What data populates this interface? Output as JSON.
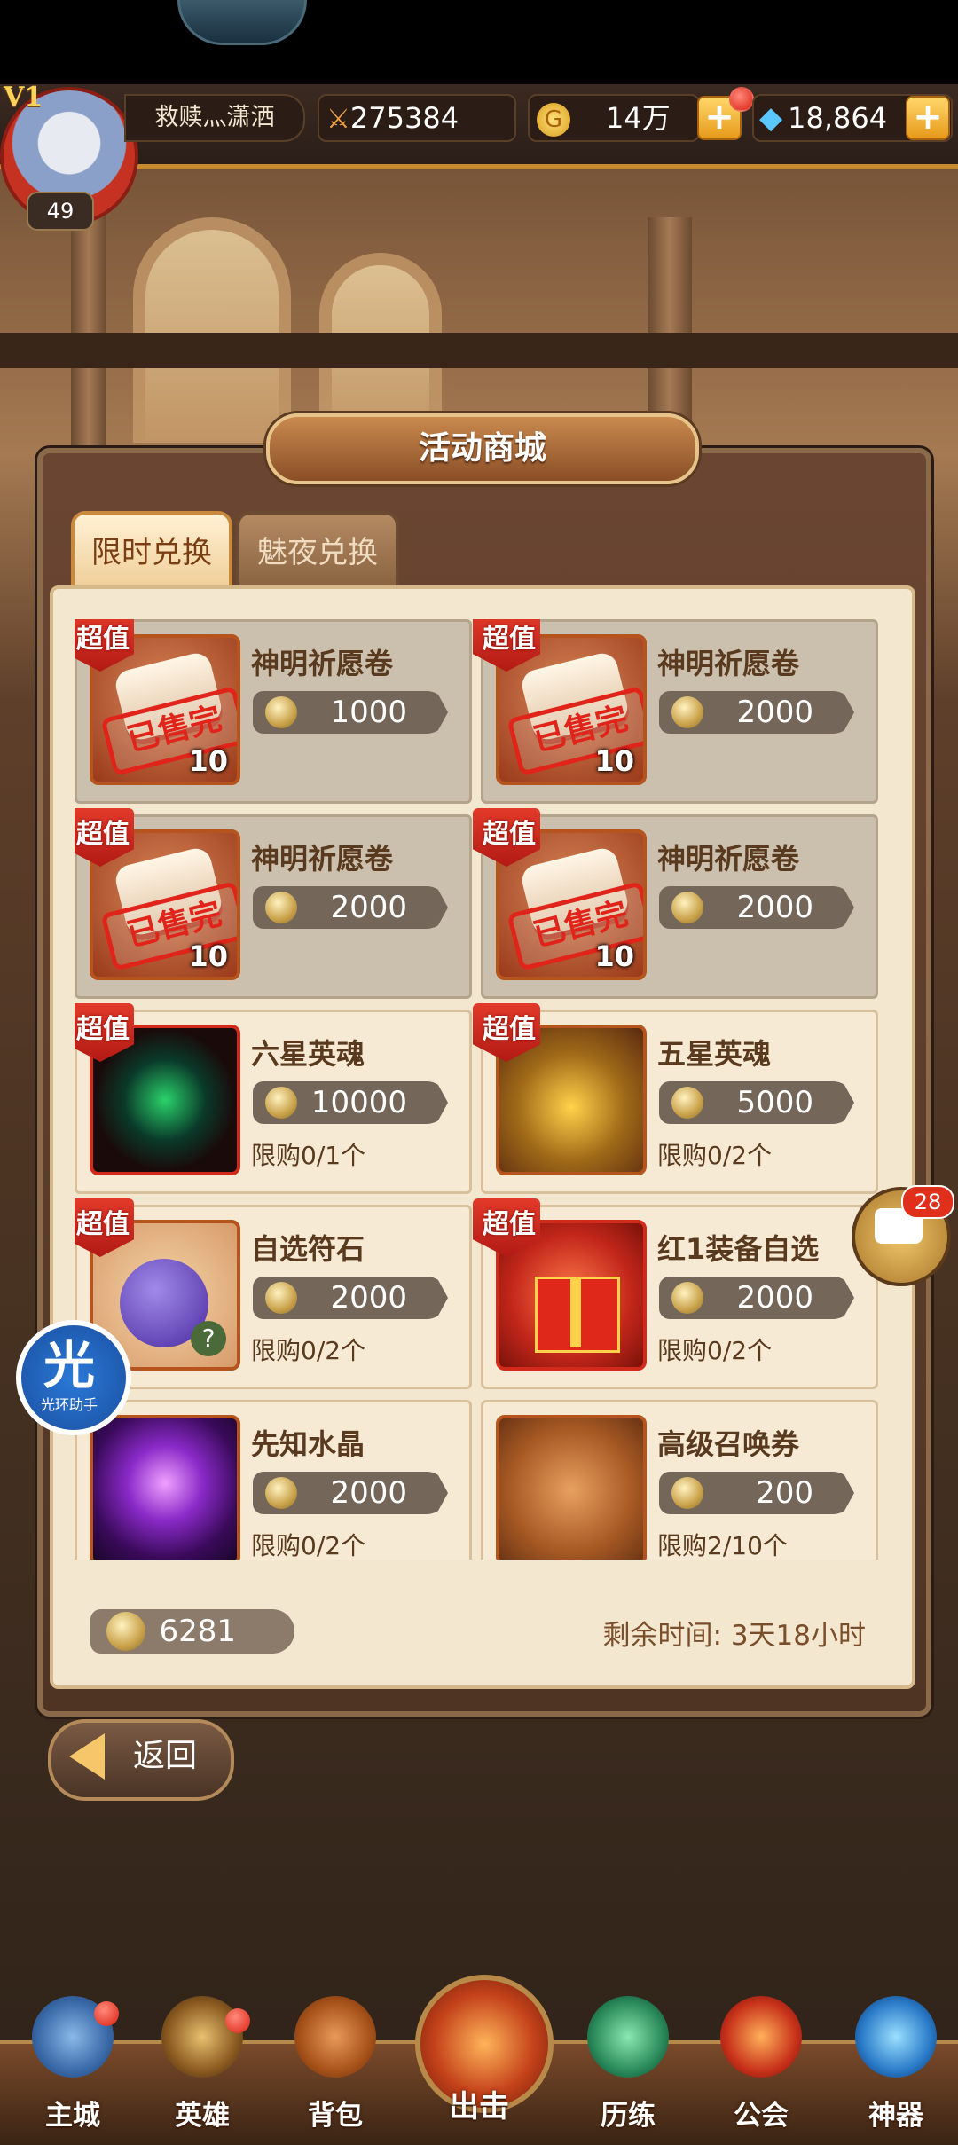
{
  "player": {
    "vip": "V1",
    "name": "救赎灬潇洒",
    "level": "49",
    "power": "275384",
    "gold": "14万",
    "gems": "18,864"
  },
  "shop": {
    "title": "活动商城",
    "tabs": [
      "限时兑换",
      "魅夜兑换"
    ],
    "sold_stamp": "已售完",
    "badge": "超值",
    "items": [
      {
        "name": "神明祈愿卷",
        "price": "1000",
        "qty": "10",
        "sold": true
      },
      {
        "name": "神明祈愿卷",
        "price": "2000",
        "qty": "10",
        "sold": true
      },
      {
        "name": "神明祈愿卷",
        "price": "2000",
        "qty": "10",
        "sold": true
      },
      {
        "name": "神明祈愿卷",
        "price": "2000",
        "qty": "10",
        "sold": true
      },
      {
        "name": "六星英魂",
        "price": "10000",
        "limit": "限购0/1个"
      },
      {
        "name": "五星英魂",
        "price": "5000",
        "limit": "限购0/2个"
      },
      {
        "name": "自选符石",
        "price": "2000",
        "limit": "限购0/2个"
      },
      {
        "name": "红1装备自选",
        "price": "2000",
        "limit": "限购0/2个"
      },
      {
        "name": "先知水晶",
        "price": "2000",
        "limit": "限购0/2个"
      },
      {
        "name": "高级召唤券",
        "price": "200",
        "limit": "限购2/10个"
      }
    ],
    "balance": "6281",
    "remaining_time": "剩余时间: 3天18小时",
    "back_label": "返回"
  },
  "chat": {
    "count": "28"
  },
  "helper": {
    "big": "光",
    "small": "光环助手"
  },
  "nav": [
    "主城",
    "英雄",
    "背包",
    "出击",
    "历练",
    "公会",
    "神器"
  ],
  "colors": {
    "accent_gold": "#f5c66a",
    "stamp_red": "#e0241a",
    "badge_red": "#d22a1a"
  }
}
